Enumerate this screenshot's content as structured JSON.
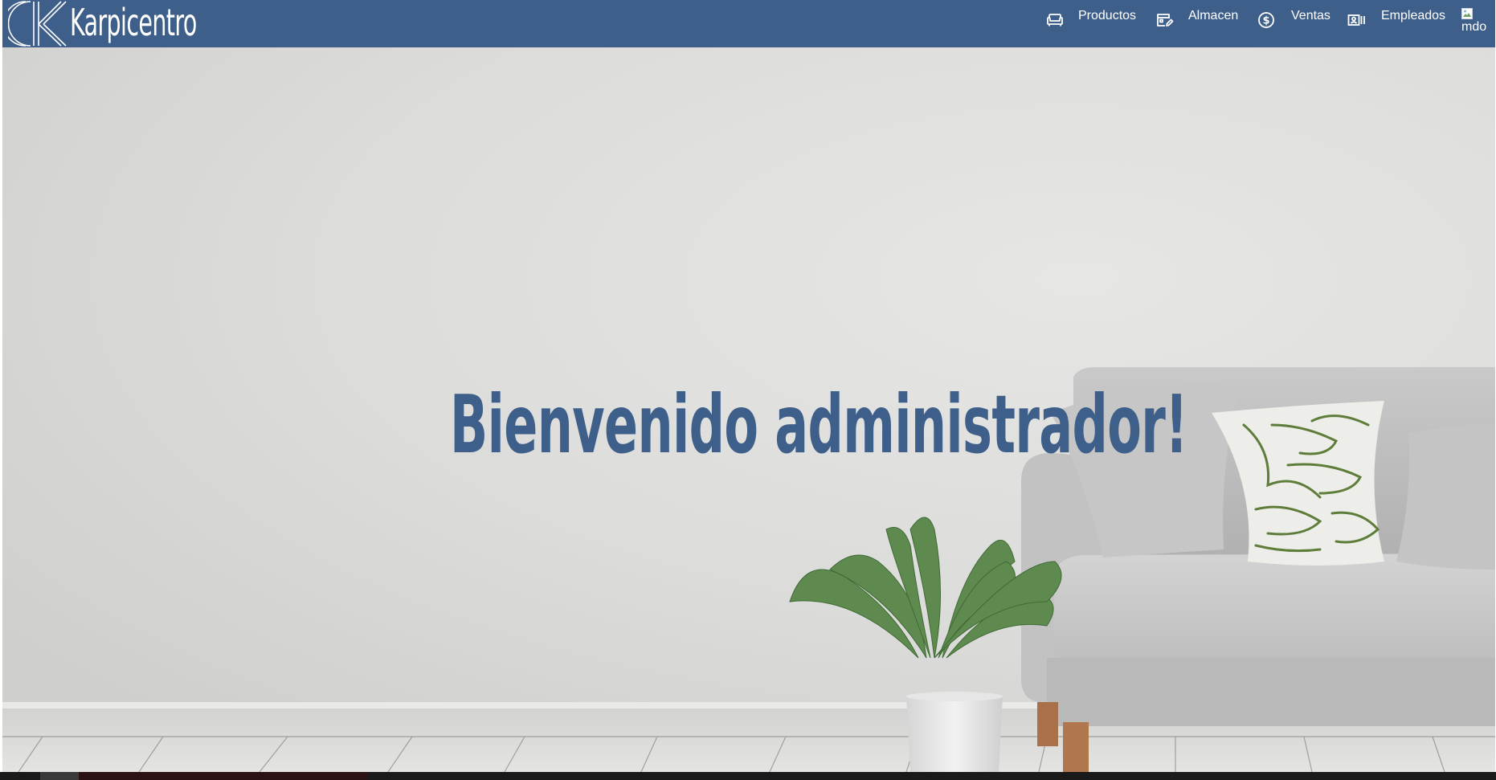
{
  "brand": {
    "name": "Karpicentro",
    "logo_icon": "k-monogram-logo"
  },
  "nav": {
    "items": [
      {
        "label": "Productos",
        "icon": "sofa-icon"
      },
      {
        "label": "Almacen",
        "icon": "inventory-edit-icon"
      },
      {
        "label": "Ventas",
        "icon": "dollar-coin-icon"
      },
      {
        "label": "Empleados",
        "icon": "employee-badge-icon"
      }
    ],
    "avatar_alt": "mdo"
  },
  "hero": {
    "welcome": "Bienvenido administrador!"
  },
  "colors": {
    "navbar": "#3e5f8a",
    "accent_text": "#3e5f8a",
    "wall": "#dedede"
  }
}
